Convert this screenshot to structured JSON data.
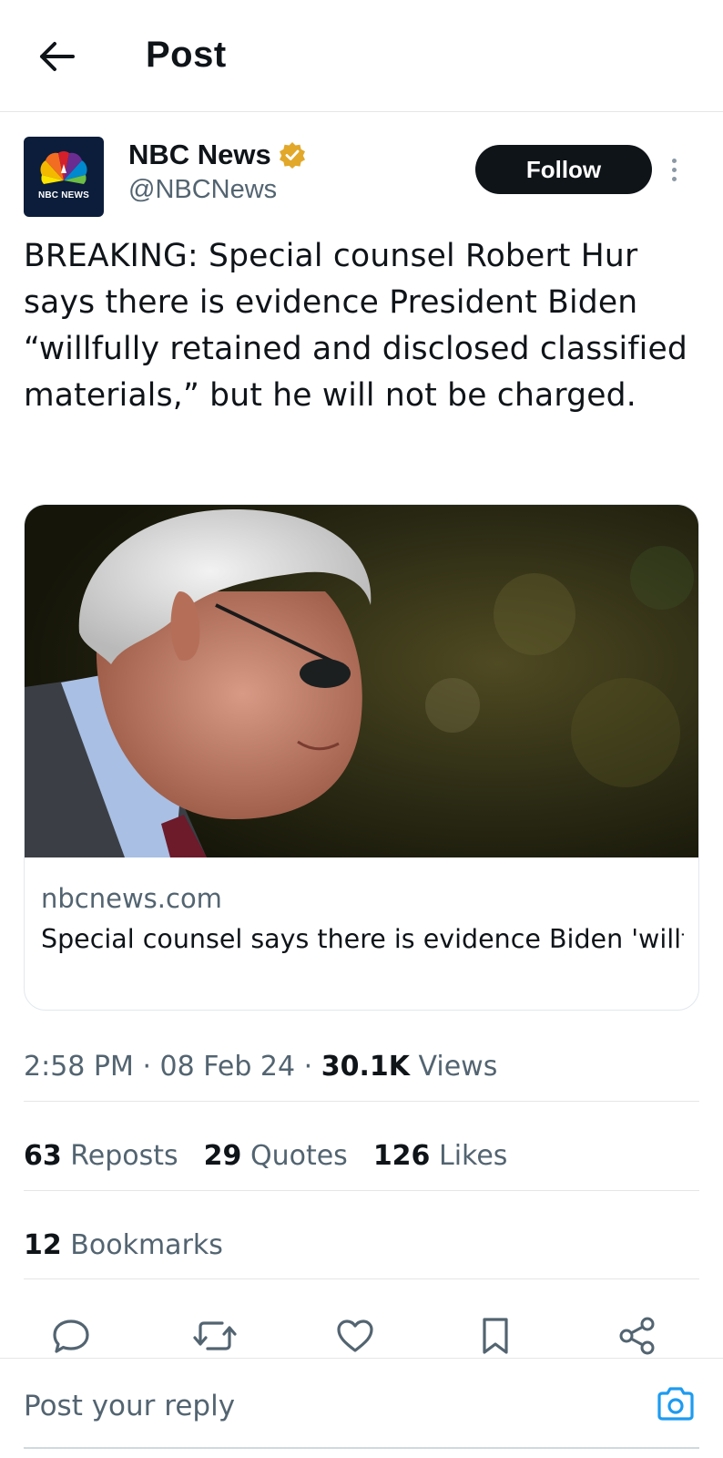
{
  "header": {
    "back_icon": "arrow-left-icon",
    "title": "Post"
  },
  "author": {
    "avatar_text": "NBC NEWS",
    "name": "NBC News",
    "verified_icon": "verified-badge-icon",
    "verified_color": "#e2a82a",
    "handle": "@NBCNews",
    "follow_label": "Follow",
    "more_icon": "more-vertical-icon"
  },
  "post": {
    "text": "BREAKING: Special counsel Robert Hur says there is evidence President Biden “willfully retained and disclosed classified materials,” but he will not be charged."
  },
  "link_card": {
    "domain": "nbcnews.com",
    "title": "Special counsel says there is evidence Biden 'willfully retained and disclosed classified ma..."
  },
  "meta": {
    "time": "2:58 PM",
    "date": "08 Feb 24",
    "separator": "·",
    "views_count": "30.1K",
    "views_label": "Views"
  },
  "stats": {
    "reposts_count": "63",
    "reposts_label": "Reposts",
    "quotes_count": "29",
    "quotes_label": "Quotes",
    "likes_count": "126",
    "likes_label": "Likes",
    "bookmarks_count": "12",
    "bookmarks_label": "Bookmarks"
  },
  "actions": [
    {
      "name": "reply",
      "icon": "reply-icon"
    },
    {
      "name": "repost",
      "icon": "repost-icon"
    },
    {
      "name": "like",
      "icon": "heart-icon"
    },
    {
      "name": "bookmark",
      "icon": "bookmark-icon"
    },
    {
      "name": "share",
      "icon": "share-icon"
    }
  ],
  "reply": {
    "placeholder": "Post your reply",
    "camera_icon": "camera-icon",
    "accent": "#1d9bf0"
  },
  "colors": {
    "text_primary": "#0f1419",
    "text_secondary": "#536471",
    "follow_bg": "#0f1419",
    "divider": "#e6e6e6"
  }
}
